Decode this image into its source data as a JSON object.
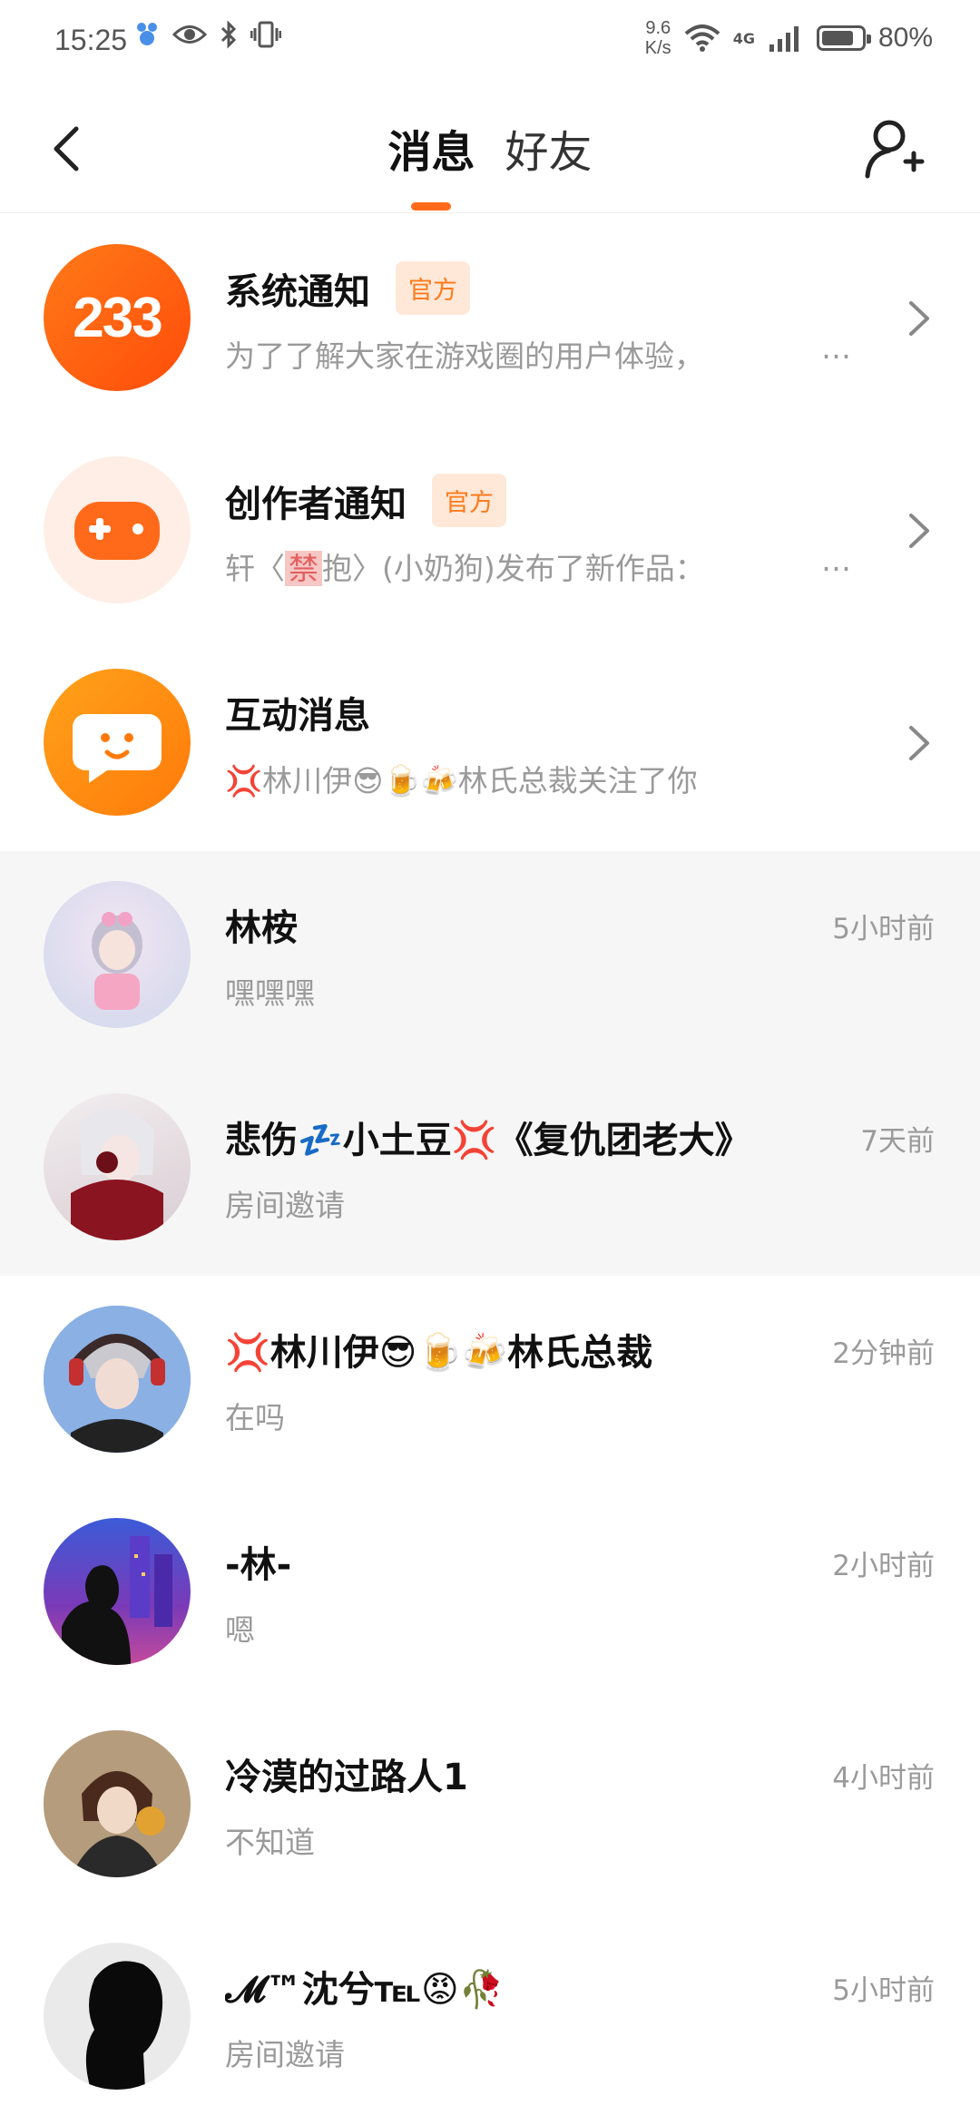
{
  "status_bar": {
    "time": "15:25",
    "net_speed_value": "9.6",
    "net_speed_unit": "K/s",
    "network": "4G",
    "battery": "80%",
    "battery_level": 0.8
  },
  "header": {
    "tabs": [
      {
        "label": "消息",
        "active": true
      },
      {
        "label": "好友",
        "active": false
      }
    ]
  },
  "system_rows": [
    {
      "title": "系统通知",
      "badge": "官方",
      "preview": "为了了解大家在游戏圈的用户体验，",
      "avatar_text": "233"
    },
    {
      "title": "创作者通知",
      "badge": "官方",
      "preview_pre": "轩〈",
      "preview_hl": "禁",
      "preview_post": "抱〉(小奶狗)发布了新作品："
    },
    {
      "title": "互动消息",
      "preview": "💢林川伊😎🍺🍻林氏总裁关注了你"
    }
  ],
  "more_glyph": "…",
  "chats": [
    {
      "name": "林桉",
      "preview": "嘿嘿嘿",
      "time": "5小时前",
      "shaded": true
    },
    {
      "name": "悲伤💤小土豆💢《复仇团老大》",
      "preview": "房间邀请",
      "time": "7天前",
      "shaded": true
    },
    {
      "name": "💢林川伊😎🍺🍻林氏总裁",
      "preview": "在吗",
      "time": "2分钟前",
      "shaded": false
    },
    {
      "name": "-林-",
      "preview": "嗯",
      "time": "2小时前",
      "shaded": false
    },
    {
      "name": "冷漠的过路人1",
      "preview": "不知道",
      "time": "4小时前",
      "shaded": false
    },
    {
      "name": "𝓜™沈兮℡😡🥀",
      "preview": "房间邀请",
      "time": "5小时前",
      "shaded": false
    }
  ],
  "colors": {
    "accent": "#ff6a1a",
    "badge_bg": "#ffe8d8",
    "badge_text": "#ff7a1a"
  }
}
